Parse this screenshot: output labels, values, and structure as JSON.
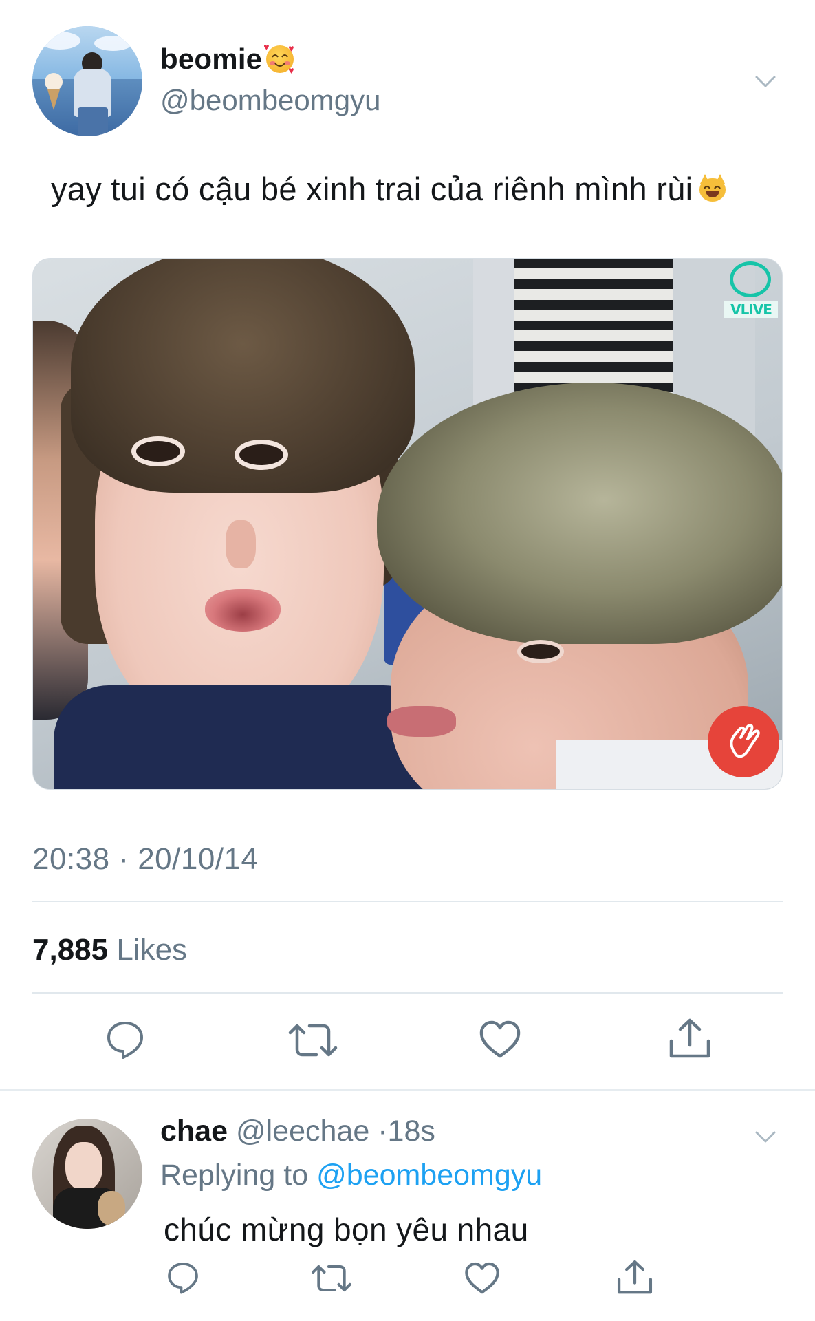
{
  "tweet": {
    "display_name": "beomie",
    "name_emoji": "smiling-face-with-hearts",
    "handle": "@beombeomgyu",
    "text": "yay tui có cậu bé xinh trai của riênh mình rùi",
    "text_emoji": "smiling-cat-face",
    "media_overlay_label": "VLIVE",
    "timestamp": "20:38 · 20/10/14",
    "likes_count": "7,885",
    "likes_label": "Likes"
  },
  "reply": {
    "display_name": "chae",
    "handle": "@leechae",
    "separator": "·",
    "time": "18s",
    "replying_prefix": "Replying to",
    "replying_to": "@beombeomgyu",
    "text": "chúc mừng bọn yêu nhau"
  },
  "icons": {
    "reply": "reply-icon",
    "retweet": "retweet-icon",
    "like": "heart-icon",
    "share": "share-icon",
    "caret": "chevron-down-icon"
  },
  "colors": {
    "text_primary": "#14171a",
    "text_secondary": "#657786",
    "link": "#1da1f2",
    "divider": "#e1e8ed",
    "vlive_accent": "#16c4a8",
    "heart_button": "#e6443a"
  }
}
